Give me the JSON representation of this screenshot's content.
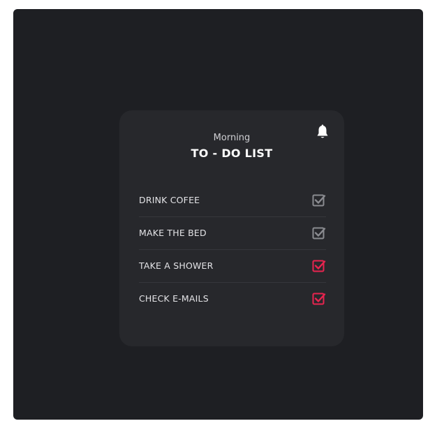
{
  "card": {
    "subtitle": "Morning",
    "title": "TO - DO LIST",
    "bell_icon": "bell-icon"
  },
  "tasks": [
    {
      "label": "DRINK COFEE",
      "checked": true,
      "style": "muted"
    },
    {
      "label": "MAKE THE BED",
      "checked": true,
      "style": "muted"
    },
    {
      "label": "TAKE A SHOWER",
      "checked": true,
      "style": "accent"
    },
    {
      "label": "CHECK E-MAILS",
      "checked": true,
      "style": "accent"
    }
  ],
  "colors": {
    "background": "#1e1f23",
    "card": "#27282c",
    "accent": "#e8244f",
    "muted_check": "#8a8b90",
    "text": "#e4e4e7"
  }
}
